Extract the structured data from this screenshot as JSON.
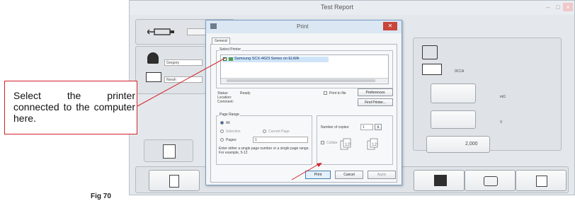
{
  "app": {
    "title": "Test Report",
    "fields": {
      "name": "Gregory",
      "battery": "Norah",
      "cca_label": "0CCA",
      "resistance_unit": "mΩ",
      "volt_unit": "V",
      "cca_value": "2,000"
    }
  },
  "dialog": {
    "title": "Print",
    "tab": "General",
    "select_printer_label": "Select Printer",
    "printer_name": "Samsung SCX-4623 Series on ELWA",
    "status_label": "Status:",
    "status_value": "Ready",
    "location_label": "Location:",
    "comment_label": "Comment:",
    "print_to_file": "Print to file",
    "preferences": "Preferences",
    "find_printer": "Find Printer...",
    "page_range_label": "Page Range",
    "all": "All",
    "selection": "Selection",
    "current_page": "Current Page",
    "pages": "Pages:",
    "pages_value": "1",
    "pages_hint": "Enter either a single page number or a single page range. For example, 5-12",
    "copies_label": "Number of copies:",
    "copies_value": "1",
    "collate": "Collate",
    "print_btn": "Print",
    "cancel_btn": "Cancel",
    "apply_btn": "Apply"
  },
  "callout": {
    "text": "Select the printer connected to the computer here."
  },
  "figure_label": "Fig 70"
}
